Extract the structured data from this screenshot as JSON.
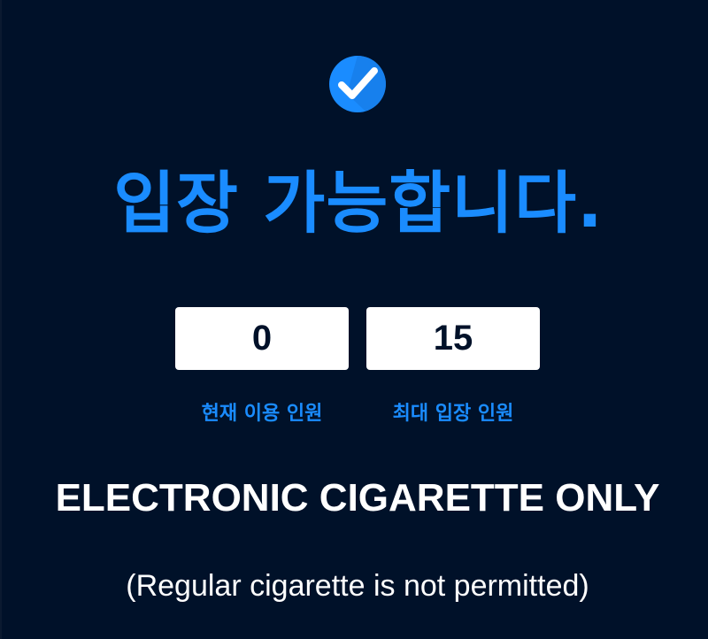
{
  "status": {
    "icon": "check-circle-icon",
    "message": "입장 가능합니다."
  },
  "counters": {
    "current": {
      "value": "0",
      "label": "현재 이용 인원"
    },
    "max": {
      "value": "15",
      "label": "최대 입장 인원"
    }
  },
  "notice": {
    "main": "ELECTRONIC CIGARETTE ONLY",
    "sub": "(Regular cigarette is not permitted)"
  },
  "colors": {
    "background": "#001129",
    "accent": "#1a8cff",
    "box": "#ffffff",
    "text": "#ffffff"
  }
}
